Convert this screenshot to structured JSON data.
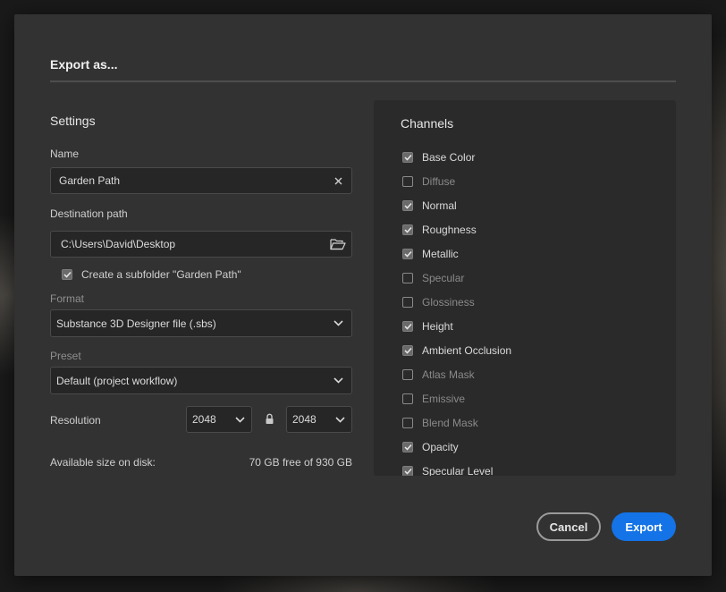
{
  "dialog": {
    "title": "Export as..."
  },
  "settings": {
    "title": "Settings",
    "name_label": "Name",
    "name_value": "Garden Path",
    "clear_glyph": "×",
    "destination_label": "Destination path",
    "destination_value": "C:\\Users\\David\\Desktop",
    "subfolder_label": "Create a subfolder \"Garden Path\"",
    "subfolder_checked": true,
    "format_label": "Format",
    "format_value": "Substance 3D Designer file (.sbs)",
    "preset_label": "Preset",
    "preset_value": "Default (project workflow)",
    "resolution_label": "Resolution",
    "resolution_width": "2048",
    "resolution_height": "2048",
    "disk_label": "Available size on disk:",
    "disk_value": "70 GB free of 930 GB"
  },
  "channels": {
    "title": "Channels",
    "items": [
      {
        "label": "Base Color",
        "checked": true
      },
      {
        "label": "Diffuse",
        "checked": false
      },
      {
        "label": "Normal",
        "checked": true
      },
      {
        "label": "Roughness",
        "checked": true
      },
      {
        "label": "Metallic",
        "checked": true
      },
      {
        "label": "Specular",
        "checked": false
      },
      {
        "label": "Glossiness",
        "checked": false
      },
      {
        "label": "Height",
        "checked": true
      },
      {
        "label": "Ambient Occlusion",
        "checked": true
      },
      {
        "label": "Atlas Mask",
        "checked": false
      },
      {
        "label": "Emissive",
        "checked": false
      },
      {
        "label": "Blend Mask",
        "checked": false
      },
      {
        "label": "Opacity",
        "checked": true
      },
      {
        "label": "Specular Level",
        "checked": true
      }
    ]
  },
  "actions": {
    "cancel_label": "Cancel",
    "export_label": "Export"
  },
  "icons": {
    "clear": "close-icon",
    "folder": "folder-open-icon",
    "chevron": "chevron-down-icon",
    "lock": "lock-icon",
    "check": "checkmark-icon"
  },
  "colors": {
    "accent": "#1473e6",
    "dialog_bg": "#323232",
    "panel_bg": "#2a2a2a"
  }
}
